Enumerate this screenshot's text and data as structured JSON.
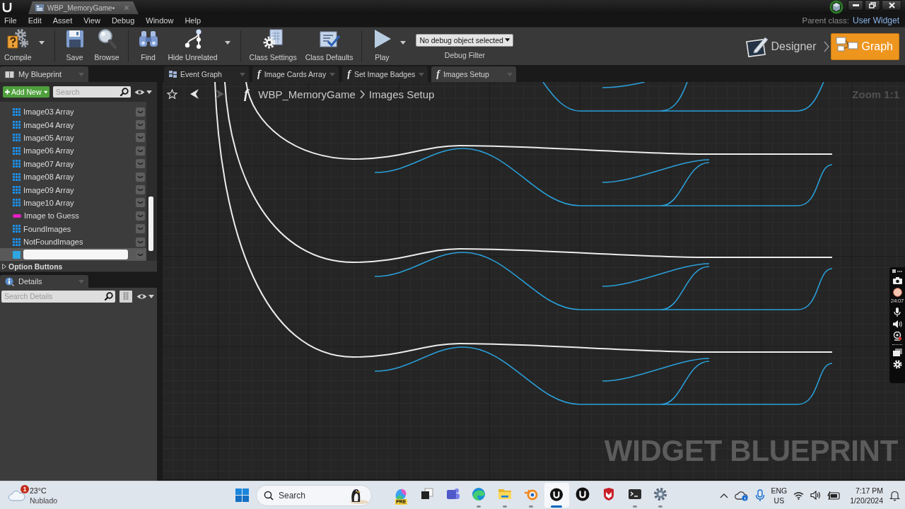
{
  "title_bar": {
    "document_tab": "WBP_MemoryGame•"
  },
  "menu_bar": {
    "items": [
      "File",
      "Edit",
      "Asset",
      "View",
      "Debug",
      "Window",
      "Help"
    ],
    "parent_class_label": "Parent class:",
    "parent_class": "User Widget"
  },
  "toolbar": {
    "groups": [
      [
        {
          "kind": "compile",
          "label": "Compile",
          "has_menu": true
        }
      ],
      [
        {
          "kind": "save",
          "label": "Save",
          "has_menu": false
        },
        {
          "kind": "browse",
          "label": "Browse",
          "has_menu": false
        }
      ],
      [
        {
          "kind": "find",
          "label": "Find",
          "has_menu": false
        },
        {
          "kind": "hide_unrelated",
          "label": "Hide Unrelated",
          "has_menu": true
        }
      ],
      [
        {
          "kind": "class_settings",
          "label": "Class Settings",
          "has_menu": false
        },
        {
          "kind": "class_defaults",
          "label": "Class Defaults",
          "has_menu": false
        }
      ],
      [
        {
          "kind": "play",
          "label": "Play",
          "has_menu": true
        }
      ]
    ],
    "debug_object": "No debug object selected",
    "debug_filter_label": "Debug Filter"
  },
  "mode_switch": [
    {
      "kind": "designer",
      "label": "Designer",
      "selected": false
    },
    {
      "kind": "graph",
      "label": "Graph",
      "selected": true
    }
  ],
  "my_blueprint": {
    "tab": "My Blueprint",
    "add_new": "Add New",
    "search_placeholder": "Search",
    "variables": [
      {
        "name": "Image03 Array",
        "kind": "array",
        "color": "#1f8ee6",
        "selected": false,
        "editing": false
      },
      {
        "name": "Image04 Array",
        "kind": "array",
        "color": "#1f8ee6",
        "selected": false,
        "editing": false
      },
      {
        "name": "Image05 Array",
        "kind": "array",
        "color": "#1f8ee6",
        "selected": false,
        "editing": false
      },
      {
        "name": "Image06 Array",
        "kind": "array",
        "color": "#1f8ee6",
        "selected": false,
        "editing": false
      },
      {
        "name": "Image07 Array",
        "kind": "array",
        "color": "#1f8ee6",
        "selected": false,
        "editing": false
      },
      {
        "name": "Image08 Array",
        "kind": "array",
        "color": "#1f8ee6",
        "selected": false,
        "editing": false
      },
      {
        "name": "Image09 Array",
        "kind": "array",
        "color": "#1f8ee6",
        "selected": false,
        "editing": false
      },
      {
        "name": "Image10 Array",
        "kind": "array",
        "color": "#1f8ee6",
        "selected": false,
        "editing": false
      },
      {
        "name": "Image to Guess",
        "kind": "single",
        "color": "#e61ec6",
        "selected": false,
        "editing": false
      },
      {
        "name": "FoundImages",
        "kind": "array",
        "color": "#1f8ee6",
        "selected": false,
        "editing": false
      },
      {
        "name": "NotFoundImages",
        "kind": "array",
        "color": "#1f8ee6",
        "selected": false,
        "editing": false
      },
      {
        "kind": "unset",
        "color": "#2ea6e0",
        "selected": true,
        "editing": true
      }
    ],
    "category": {
      "label": "Option Buttons",
      "expanded": false
    }
  },
  "details": {
    "tab": "Details",
    "search_placeholder": "Search Details"
  },
  "graph_tabs": [
    {
      "kind": "event_graph",
      "label": "Event Graph",
      "selected": false
    },
    {
      "kind": "function",
      "icon": "f",
      "label": "Image Cards Array",
      "selected": false
    },
    {
      "kind": "function",
      "icon": "f",
      "label": "Set Image Badges",
      "selected": false
    },
    {
      "kind": "function",
      "icon": "f",
      "label": "Images Setup",
      "selected": true
    }
  ],
  "graph": {
    "function_icon": "f",
    "breadcrumb": [
      "WBP_MemoryGame",
      "Images Setup"
    ],
    "zoom": "Zoom 1:1",
    "label": "WIDGET BLUEPRINT"
  },
  "recorder": {
    "timer": "24:07"
  },
  "taskbar": {
    "weather": {
      "alerts": "1",
      "temperature": "23°C",
      "condition": "Nublado"
    },
    "search_placeholder": "Search",
    "apps": [
      {
        "kind": "copilot",
        "badge": "PRE",
        "running": false,
        "active": false
      },
      {
        "kind": "task_view",
        "running": false,
        "active": false
      },
      {
        "kind": "teams",
        "running": false,
        "active": false
      },
      {
        "kind": "edge",
        "running": true,
        "active": false
      },
      {
        "kind": "explorer",
        "running": true,
        "active": false
      },
      {
        "kind": "blender",
        "running": true,
        "active": false
      },
      {
        "kind": "unreal",
        "running": true,
        "active": true
      },
      {
        "kind": "unreal",
        "running": false,
        "active": false
      },
      {
        "kind": "mcafee",
        "running": false,
        "active": false
      },
      {
        "kind": "terminal",
        "running": true,
        "active": false
      },
      {
        "kind": "settings",
        "running": true,
        "active": false
      }
    ],
    "tray": {
      "language": "ENG",
      "region": "US",
      "time": "7:17 PM",
      "date": "1/20/2024"
    }
  }
}
